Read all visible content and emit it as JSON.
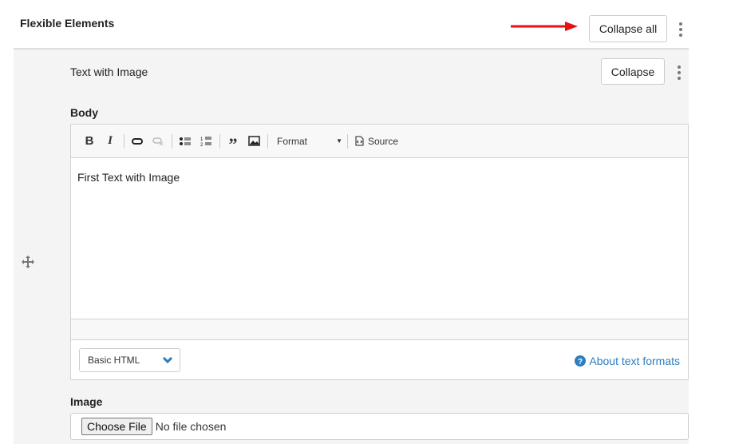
{
  "header": {
    "title": "Flexible Elements",
    "collapse_all": "Collapse all"
  },
  "item": {
    "title": "Text with Image",
    "collapse": "Collapse"
  },
  "body_field": {
    "label": "Body",
    "toolbar": {
      "format": "Format",
      "source": "Source"
    },
    "content": "First Text with Image",
    "format_select": "Basic HTML",
    "about_link": "About text formats"
  },
  "image_field": {
    "label": "Image",
    "choose_file": "Choose File",
    "no_file": "No file chosen"
  },
  "colors": {
    "arrow": "#e81010",
    "link": "#2f7dc1",
    "panel": "#f4f4f4"
  }
}
